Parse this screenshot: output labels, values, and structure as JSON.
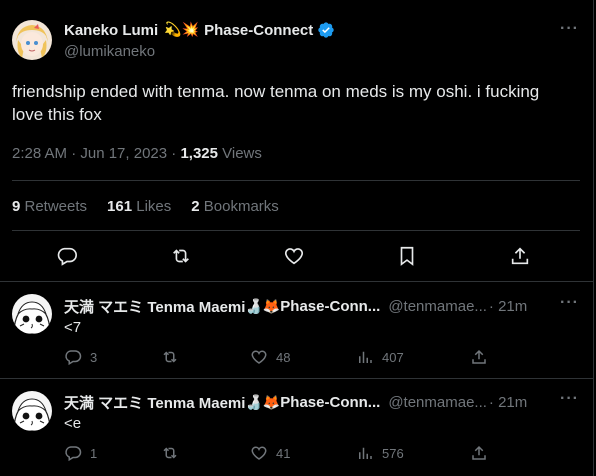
{
  "main_tweet": {
    "author_name": "Kaneko Lumi",
    "author_emojis": "💫💥",
    "author_suffix": "Phase-Connect",
    "handle": "@lumikaneko",
    "text": "friendship ended with tenma. now tenma on meds is my oshi. i fucking love this fox",
    "timestamp": "2:28 AM · Jun 17, 2023 · ",
    "views_count": "1,325",
    "views_label": " Views",
    "stats": {
      "retweets_count": "9",
      "retweets_label": " Retweets",
      "likes_count": "161",
      "likes_label": " Likes",
      "bookmarks_count": "2",
      "bookmarks_label": " Bookmarks"
    },
    "actions": [
      "reply-icon",
      "retweet-icon",
      "like-icon",
      "bookmark-icon",
      "share-icon"
    ]
  },
  "replies": [
    {
      "author_name": "天満 マエミ Tenma Maemi",
      "author_emojis": "🍶🦊",
      "author_suffix": "Phase-Conn...",
      "handle": "@tenmamae...",
      "time": " · 21m",
      "text": "<7",
      "reply_count": "3",
      "retweet_count": "",
      "like_count": "48",
      "view_count": "407"
    },
    {
      "author_name": "天満 マエミ Tenma Maemi",
      "author_emojis": "🍶🦊",
      "author_suffix": "Phase-Conn...",
      "handle": "@tenmamae...",
      "time": " · 21m",
      "text": "<e",
      "reply_count": "1",
      "retweet_count": "",
      "like_count": "41",
      "view_count": "576"
    }
  ],
  "colors": {
    "background": "#000000",
    "text": "#e7e9ea",
    "muted": "#71767b",
    "divider": "#2f3336",
    "verified": "#1d9bf0"
  }
}
